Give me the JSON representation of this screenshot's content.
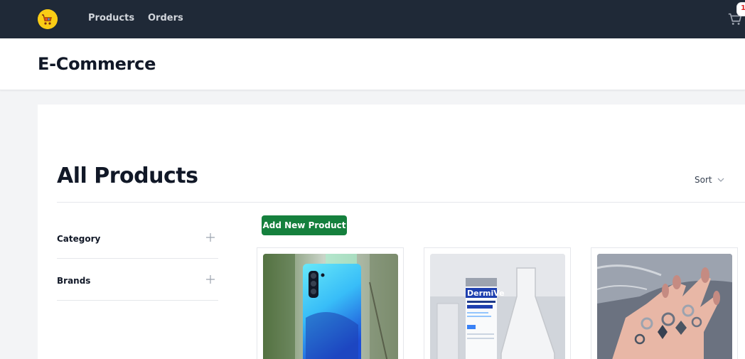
{
  "nav": {
    "links": [
      {
        "label": "Products"
      },
      {
        "label": "Orders"
      }
    ],
    "cart": {
      "count": "1",
      "icon": "cart-icon"
    },
    "logo_icon": "store-logo-icon"
  },
  "header": {
    "title": "E-Commerce"
  },
  "main": {
    "heading": "All Products",
    "sort_label": "Sort",
    "add_button_label": "Add New Product",
    "filters": [
      {
        "label": "Category"
      },
      {
        "label": "Brands"
      }
    ],
    "products": [
      {
        "image": "smartphone-image"
      },
      {
        "image": "moisturizer-image",
        "visible_text": "DermiVe"
      },
      {
        "image": "jewelry-rings-image"
      }
    ]
  },
  "colors": {
    "nav_bg": "#1f2937",
    "accent_green": "#15803d",
    "logo_yellow": "#facc15"
  }
}
